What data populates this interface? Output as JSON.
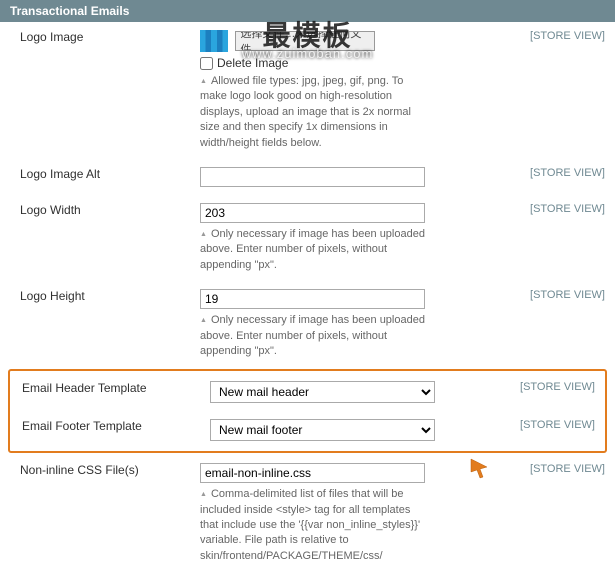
{
  "section": {
    "title": "Transactional Emails"
  },
  "scope": {
    "label": "[STORE VIEW]"
  },
  "watermark": {
    "main": "最模板",
    "sub": "www.zuimoban.com"
  },
  "fields": {
    "logoImage": {
      "label": "Logo Image",
      "fileButton": "选择文件…未选择任何文件",
      "deleteLabel": "Delete Image",
      "note": "Allowed file types: jpg, jpeg, gif, png. To make logo look good on high-resolution displays, upload an image that is 2x normal size and then specify 1x dimensions in width/height fields below."
    },
    "logoImageAlt": {
      "label": "Logo Image Alt",
      "value": ""
    },
    "logoWidth": {
      "label": "Logo Width",
      "value": "203",
      "note": "Only necessary if image has been uploaded above. Enter number of pixels, without appending \"px\"."
    },
    "logoHeight": {
      "label": "Logo Height",
      "value": "19",
      "note": "Only necessary if image has been uploaded above. Enter number of pixels, without appending \"px\"."
    },
    "headerTemplate": {
      "label": "Email Header Template",
      "value": "New mail header"
    },
    "footerTemplate": {
      "label": "Email Footer Template",
      "value": "New mail footer"
    },
    "nonInlineCss": {
      "label": "Non-inline CSS File(s)",
      "value": "email-non-inline.css",
      "note": "Comma-delimited list of files that will be included inside <style> tag for all templates that include use the '{{var non_inline_styles}}' variable. File path is relative to skin/frontend/PACKAGE/THEME/css/"
    }
  }
}
